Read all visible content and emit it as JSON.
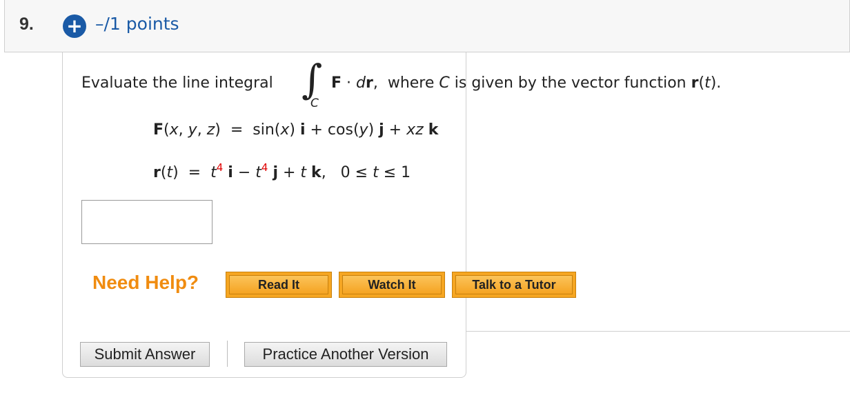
{
  "question": {
    "number": "9.",
    "plus_icon": "+",
    "points": "–/1 points"
  },
  "problem": {
    "prompt_lead": "Evaluate the line integral",
    "integral_symbol": "∫",
    "integral_subscript": "C",
    "F_bold": "F",
    "dot": " · ",
    "d_italic": "d",
    "r_bold": "r",
    "after_integrand": ",  where ",
    "C_italic": "C",
    "prompt_tail": " is given by the vector function ",
    "r_func_bold": "r",
    "r_func_open": "(",
    "t_italic": "t",
    "r_func_close": ")."
  },
  "equation1": {
    "F": "F",
    "open": "(",
    "x": "x",
    "comma1": ", ",
    "y": "y",
    "comma2": ", ",
    "z": "z",
    "close": ")  =  sin(",
    "x2": "x",
    "sin_close": ") ",
    "i": "i",
    "plus1": " + cos(",
    "y2": "y",
    "cos_close": ") ",
    "j": "j",
    "plus2": " + ",
    "xz": "xz",
    "k": "k"
  },
  "equation2": {
    "r": "r",
    "open": "(",
    "t": "t",
    "close_eq": ")  =  ",
    "t1": "t",
    "exp1": "4",
    "i": "i",
    "minus": " − ",
    "t2": "t",
    "exp2": "4",
    "j": "j",
    "plus": " + ",
    "t3": "t",
    "k": "k",
    "range_pre": ",   0 ≤ ",
    "t4": "t",
    "range_post": " ≤ 1"
  },
  "help": {
    "label": "Need Help?",
    "read_it": "Read It",
    "watch_it": "Watch It",
    "talk_to_tutor": "Talk to a Tutor"
  },
  "actions": {
    "submit": "Submit Answer",
    "practice": "Practice Another Version"
  },
  "colors": {
    "accent_blue": "#1a5aa6",
    "help_orange": "#f08c10",
    "button_orange": "#f6a622",
    "exponent_red": "#e00000"
  }
}
